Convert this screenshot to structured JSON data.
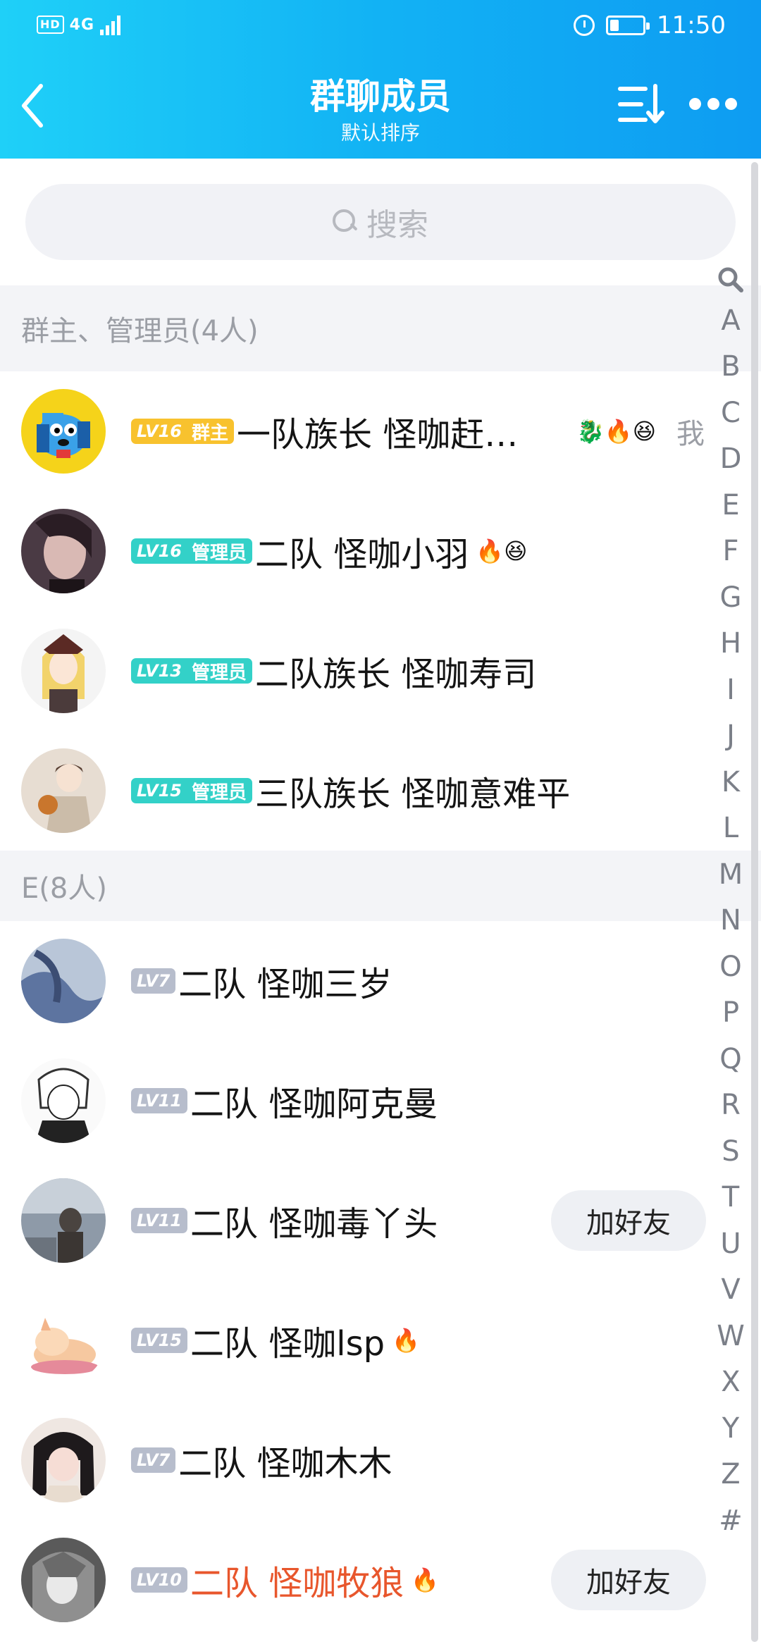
{
  "status_bar": {
    "network": "4G",
    "hd": "HD",
    "time": "11:50"
  },
  "header": {
    "title": "群聊成员",
    "subtitle": "默认排序",
    "back_icon": "chevron-left-icon",
    "sort_icon": "sort-icon",
    "more_icon": "more-dots-icon"
  },
  "search": {
    "placeholder": "搜索"
  },
  "sections": [
    {
      "label": "群主、管理员(4人)"
    },
    {
      "label": "E(8人)"
    }
  ],
  "members": [
    {
      "level": "LV16",
      "role": "群主",
      "name": "一队族长  怪咖赶…",
      "emojis": "🐉🔥😆",
      "suffix": "我"
    },
    {
      "level": "LV16",
      "role": "管理员",
      "name": "二队   怪咖小羽",
      "emojis": "🔥😆"
    },
    {
      "level": "LV13",
      "role": "管理员",
      "name": "二队族长  怪咖寿司",
      "emojis": ""
    },
    {
      "level": "LV15",
      "role": "管理员",
      "name": "三队族长  怪咖意难平",
      "emojis": ""
    },
    {
      "level": "LV7",
      "name": "二队   怪咖三岁",
      "emojis": ""
    },
    {
      "level": "LV11",
      "name": "二队  怪咖阿克曼",
      "emojis": ""
    },
    {
      "level": "LV11",
      "name": "二队  怪咖毒丫头",
      "emojis": "",
      "action": "加好友"
    },
    {
      "level": "LV15",
      "name": "二队  怪咖lsp",
      "emojis": "🔥"
    },
    {
      "level": "LV7",
      "name": "二队  怪咖木木",
      "emojis": ""
    },
    {
      "level": "LV10",
      "name": "二队 怪咖牧狼",
      "emojis": "🔥",
      "action": "加好友",
      "name_color": "#e8562c"
    }
  ],
  "index_bar": [
    "A",
    "B",
    "C",
    "D",
    "E",
    "F",
    "G",
    "H",
    "I",
    "J",
    "K",
    "L",
    "M",
    "N",
    "O",
    "P",
    "Q",
    "R",
    "S",
    "T",
    "U",
    "V",
    "W",
    "X",
    "Y",
    "Z",
    "#"
  ],
  "colors": {
    "header_start": "#1fd0f8",
    "header_end": "#0e9cf2",
    "owner_badge": "#f8c22e",
    "admin_badge": "#33d1c8",
    "member_badge": "#b7bdcc",
    "highlight_name": "#e8562c"
  }
}
